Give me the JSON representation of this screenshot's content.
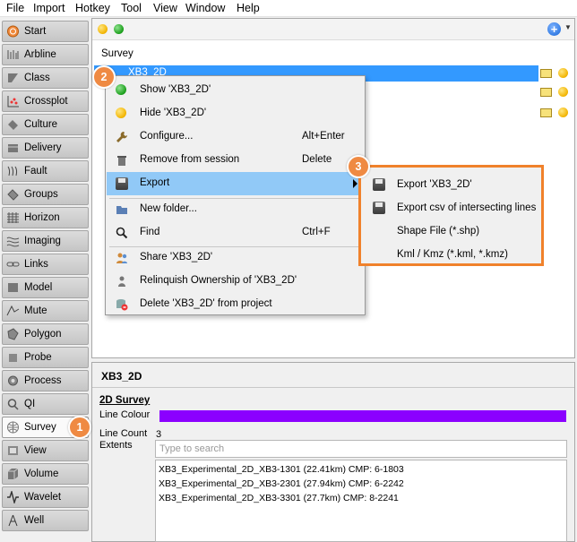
{
  "menubar": [
    "File",
    "Import",
    "Hotkey",
    "Tool",
    "View",
    "Window",
    "Help"
  ],
  "sidebar": {
    "items": [
      "Start",
      "Arbline",
      "Class",
      "Crossplot",
      "Culture",
      "Delivery",
      "Fault",
      "Groups",
      "Horizon",
      "Imaging",
      "Links",
      "Model",
      "Mute",
      "Polygon",
      "Probe",
      "Process",
      "QI",
      "Survey",
      "View",
      "Volume",
      "Wavelet",
      "Well"
    ],
    "active": "Survey"
  },
  "tree": {
    "header": "Survey",
    "selected_label": "XB3_2D"
  },
  "context_menu": {
    "items": [
      {
        "label": "Show 'XB3_2D'",
        "shortcut": "",
        "icon": "green-dot-icon"
      },
      {
        "label": "Hide 'XB3_2D'",
        "shortcut": "",
        "icon": "yellow-dot-icon"
      },
      {
        "label": "Configure...",
        "shortcut": "Alt+Enter",
        "icon": "wrench-icon"
      },
      {
        "label": "Remove from session",
        "shortcut": "Delete",
        "icon": "trash-icon"
      },
      {
        "label": "Export",
        "shortcut": "",
        "icon": "floppy-disk-icon"
      },
      {
        "label": "New folder...",
        "shortcut": "",
        "icon": "folder-icon"
      },
      {
        "label": "Find",
        "shortcut": "Ctrl+F",
        "icon": "magnifier-icon"
      },
      {
        "label": "Share 'XB3_2D'",
        "shortcut": "",
        "icon": "share-users-icon"
      },
      {
        "label": "Relinquish Ownership of 'XB3_2D'",
        "shortcut": "",
        "icon": "relinquish-user-icon"
      },
      {
        "label": "Delete 'XB3_2D' from project",
        "shortcut": "",
        "icon": "delete-database-icon"
      }
    ]
  },
  "submenu": {
    "items": [
      "Export 'XB3_2D'",
      "Export csv of intersecting lines",
      "Shape File (*.shp)",
      "Kml / Kmz (*.kml, *.kmz)"
    ]
  },
  "details": {
    "title": "XB3_2D",
    "heading": "2D Survey",
    "line_colour_label": "Line Colour",
    "line_colour": "#8b00ff",
    "line_count_label": "Line Count",
    "line_count": "3",
    "extents_label": "Extents",
    "search_placeholder": "Type to search",
    "lines": [
      "XB3_Experimental_2D_XB3-1301 (22.41km) CMP: 6-1803",
      "XB3_Experimental_2D_XB3-2301 (27.94km) CMP: 6-2242",
      "XB3_Experimental_2D_XB3-3301 (27.7km) CMP: 8-2241"
    ]
  },
  "badges": [
    "1",
    "2",
    "3"
  ],
  "colors": {
    "accent": "#ef8a43",
    "selection": "#3399ff",
    "menu_highlight": "#91c9f7"
  }
}
